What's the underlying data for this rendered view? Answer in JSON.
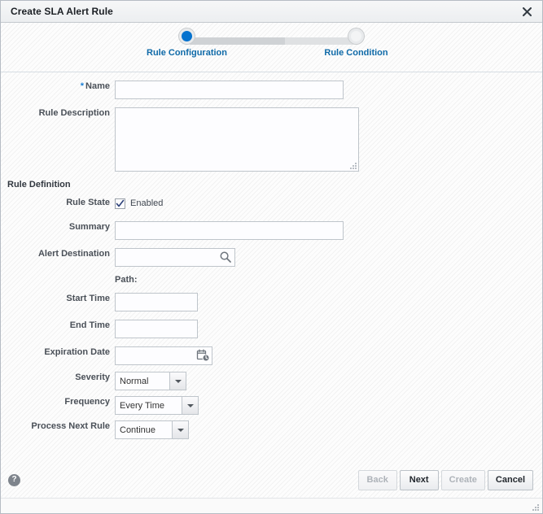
{
  "dialog": {
    "title": "Create SLA Alert Rule",
    "close_icon": "close-icon"
  },
  "train": {
    "steps": [
      {
        "label": "Rule Configuration",
        "state": "active"
      },
      {
        "label": "Rule Condition",
        "state": "inactive"
      }
    ]
  },
  "form": {
    "name": {
      "label": "Name",
      "required_marker": "*",
      "value": "",
      "placeholder": ""
    },
    "rule_description": {
      "label": "Rule Description",
      "value": "",
      "placeholder": ""
    },
    "section_title": "Rule Definition",
    "rule_state": {
      "label": "Rule State",
      "checkbox_label": "Enabled",
      "checked": true,
      "check_glyph": "✓"
    },
    "summary": {
      "label": "Summary",
      "value": "",
      "placeholder": ""
    },
    "alert_destination": {
      "label": "Alert Destination",
      "value": "",
      "placeholder": "",
      "icon": "search-icon"
    },
    "path": {
      "label": "Path:",
      "value": ""
    },
    "start_time": {
      "label": "Start Time",
      "value": "",
      "placeholder": ""
    },
    "end_time": {
      "label": "End Time",
      "value": "",
      "placeholder": ""
    },
    "expiration_date": {
      "label": "Expiration Date",
      "value": "",
      "placeholder": "",
      "icon": "calendar-clock-icon"
    },
    "severity": {
      "label": "Severity",
      "value": "Normal",
      "options": [
        "Normal"
      ]
    },
    "frequency": {
      "label": "Frequency",
      "value": "Every Time",
      "options": [
        "Every Time"
      ]
    },
    "process_next_rule": {
      "label": "Process Next Rule",
      "value": "Continue",
      "options": [
        "Continue"
      ]
    }
  },
  "footer": {
    "help_icon": "help-icon",
    "help_glyph": "?",
    "buttons": [
      {
        "label": "Back",
        "enabled": false
      },
      {
        "label": "Next",
        "enabled": true
      },
      {
        "label": "Create",
        "enabled": false
      },
      {
        "label": "Cancel",
        "enabled": true
      }
    ]
  },
  "colors": {
    "accent_blue": "#0572ce",
    "link_blue": "#0f6aa8",
    "required_star": "#1b7fd4",
    "label_text": "#4a5058",
    "titlebar_text": "#1b1f24"
  }
}
